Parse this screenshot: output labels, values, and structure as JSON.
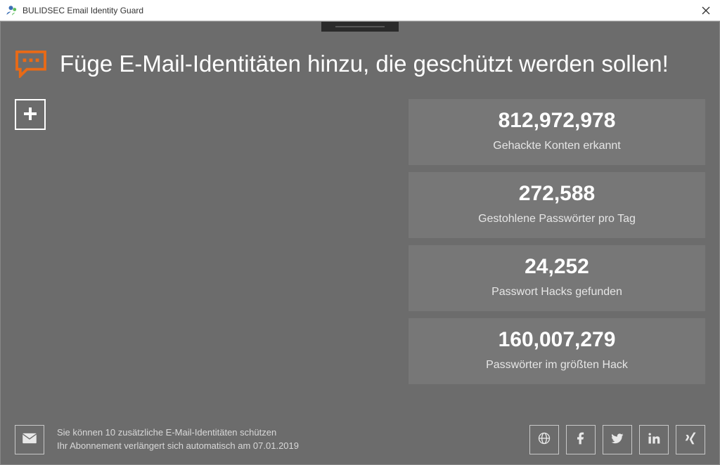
{
  "window": {
    "title": "BULIDSEC Email Identity Guard"
  },
  "header": {
    "text": "Füge E-Mail-Identitäten hinzu, die geschützt werden sollen!"
  },
  "stats": [
    {
      "value": "812,972,978",
      "label": "Gehackte Konten erkannt"
    },
    {
      "value": "272,588",
      "label": "Gestohlene Passwörter pro Tag"
    },
    {
      "value": "24,252",
      "label": "Passwort Hacks gefunden"
    },
    {
      "value": "160,007,279",
      "label": "Passwörter im größten Hack"
    }
  ],
  "footer": {
    "line1": "Sie können 10 zusätzliche E-Mail-Identitäten schützen",
    "line2": "Ihr Abonnement verlängert sich automatisch am 07.01.2019"
  },
  "social": {
    "globe": "globe-icon",
    "facebook": "facebook-icon",
    "twitter": "twitter-icon",
    "linkedin": "linkedin-icon",
    "xing": "xing-icon"
  },
  "colors": {
    "accent": "#e96a16",
    "panel": "#6c6c6c",
    "card": "#777777"
  }
}
